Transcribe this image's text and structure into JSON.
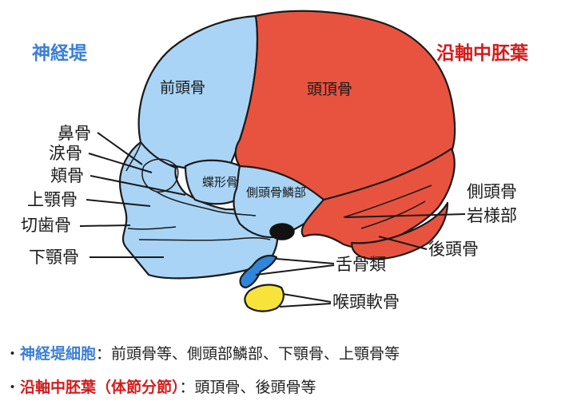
{
  "colors": {
    "neural_crest": "#a9d4f5",
    "neural_crest_title": "#3d7fd6",
    "mesoderm": "#e8533f",
    "mesoderm_title": "#d21c1c",
    "hyoid": "#2f86d9",
    "larynx": "#f7e33a",
    "outline": "#1a1a1a"
  },
  "titles": {
    "neural_crest": "神経堤",
    "paraxial_mesoderm": "沿軸中胚葉"
  },
  "labels": {
    "frontal": "前頭骨",
    "parietal": "頭頂骨",
    "sphenoid": "蝶形骨",
    "squamous_temporal": "側頭骨鱗部",
    "nasal": "鼻骨",
    "lacrimal": "涙骨",
    "zygomatic": "頬骨",
    "maxilla": "上顎骨",
    "incisive": "切歯骨",
    "mandible": "下顎骨",
    "petrous_temporal_line1": "側頭骨",
    "petrous_temporal_line2": "岩様部",
    "occipital": "後頭骨",
    "hyoid": "舌骨類",
    "larynx": "喉頭軟骨"
  },
  "legend": {
    "row1": {
      "bullet": "・",
      "term": "神経堤細胞",
      "text": "：前頭骨等、側頭部鱗部、下顎骨、上顎骨等"
    },
    "row2": {
      "bullet": "・",
      "term": "沿軸中胚葉（体節分節）",
      "text": "：頭頂骨、後頭骨等"
    }
  }
}
